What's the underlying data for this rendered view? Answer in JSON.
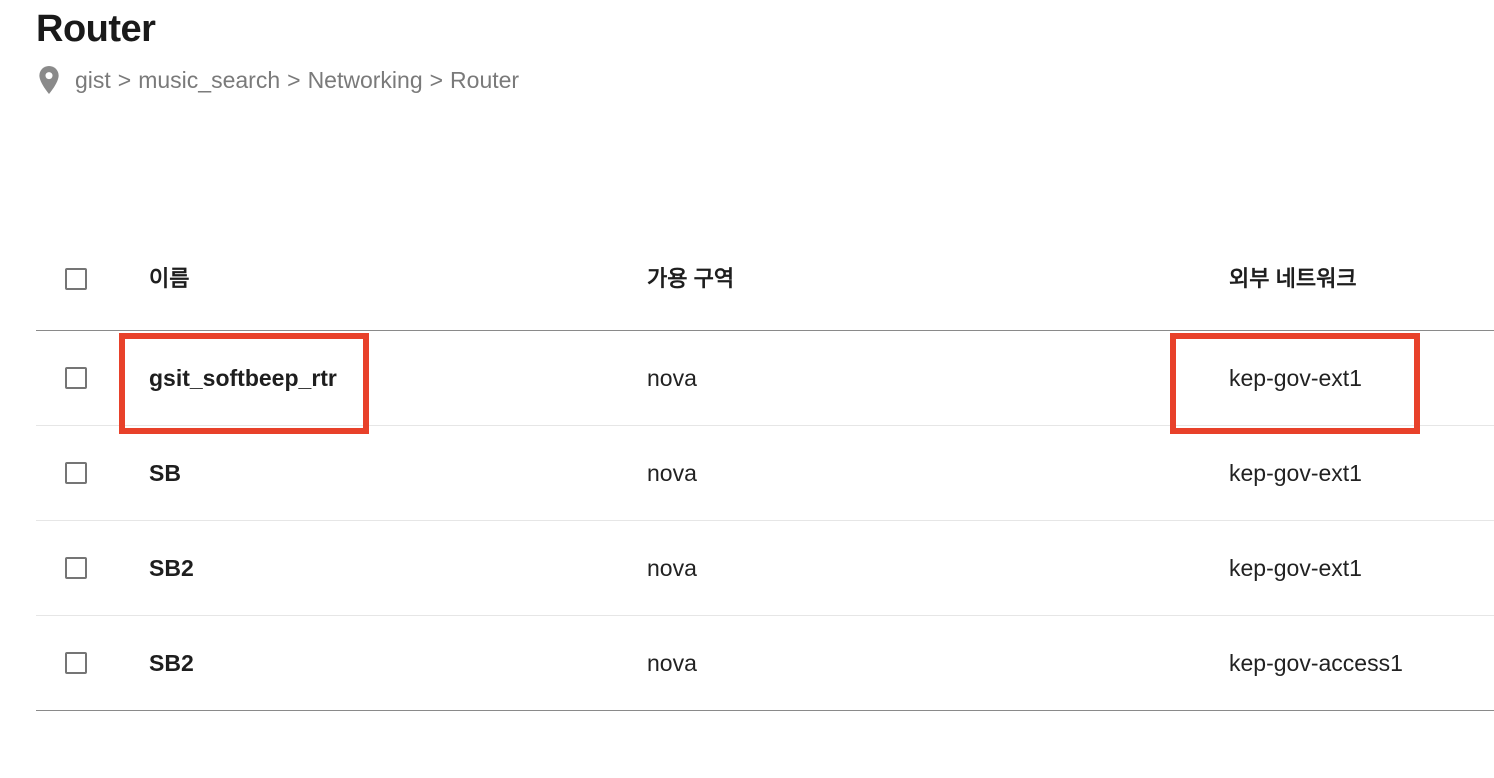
{
  "page": {
    "title": "Router"
  },
  "breadcrumb": {
    "icon": "location-pin-icon",
    "items": [
      "gist",
      "music_search",
      "Networking",
      "Router"
    ],
    "separator": ">"
  },
  "table": {
    "headers": {
      "name": "이름",
      "availability_zone": "가용 구역",
      "external_network": "외부 네트워크"
    },
    "rows": [
      {
        "name": "gsit_softbeep_rtr",
        "availability_zone": "nova",
        "external_network": "kep-gov-ext1"
      },
      {
        "name": "SB",
        "availability_zone": "nova",
        "external_network": "kep-gov-ext1"
      },
      {
        "name": "SB2",
        "availability_zone": "nova",
        "external_network": "kep-gov-ext1"
      },
      {
        "name": "SB2",
        "availability_zone": "nova",
        "external_network": "kep-gov-access1"
      }
    ]
  },
  "colors": {
    "highlight": "#e8412a",
    "breadcrumb_text": "#7a7a7a",
    "title_text": "#1a1a1a"
  }
}
